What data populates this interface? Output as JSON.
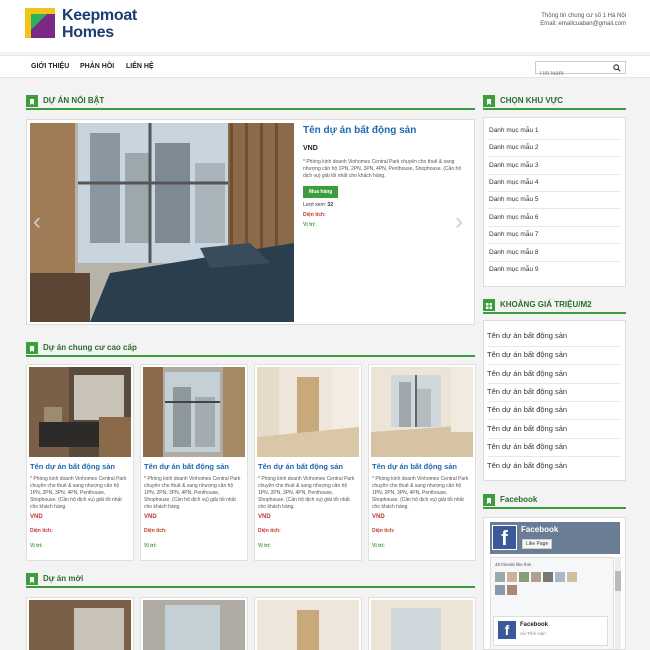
{
  "brand": {
    "logo_line1": "Keepmoat",
    "logo_line2": "Homes"
  },
  "contact": {
    "line1": "Thông tin chung cư số 1 Hà Nội",
    "line2": "Email: emailcuaban@gmail.com"
  },
  "nav": {
    "items": [
      "GIỚI THIỆU",
      "PHẢN HỒI",
      "LIÊN HỆ"
    ],
    "search_placeholder": "Tìm kiếm"
  },
  "featured": {
    "heading": "DỰ ÁN NỔI BẬT",
    "title": "Tên dự án bất động sản",
    "price": "VND",
    "description": "* Phòng kinh doanh Vinhomes Central Park chuyên cho thuê & sang nhượng căn hộ 1PN, 2PN, 3PN, 4PN, Penthouse, Shophouse. (Cần hộ dịch vụ) giải tối nhất cho khách hàng.",
    "buy_label": "Mua hàng",
    "views_label": "Lượt xem:",
    "views_value": "32",
    "area_label": "Diện tích:",
    "location_label": "Vị trí:"
  },
  "section1": {
    "heading": "Dự án chung cư cao cấp",
    "cards": [
      {
        "title": "Tên dự án bất động sản",
        "desc": "* Phòng kinh doanh Vinhomes Central Park chuyên cho thuê & sang nhượng căn hộ 1PN, 2PN, 3PN, 4PN, Penthouse, Shophouse. (Cần hộ dịch vụ) giải tối nhất cho khách hàng.",
        "price": "VND",
        "area": "Diện tích:",
        "loc": "Vị trí:"
      },
      {
        "title": "Tên dự án bất động sản",
        "desc": "* Phòng kinh doanh Vinhomes Central Park chuyên cho thuê & sang nhượng căn hộ 1PN, 2PN, 3PN, 4PN, Penthouse, Shophouse. (Cần hộ dịch vụ) giải tối nhất cho khách hàng.",
        "price": "VND",
        "area": "Diện tích:",
        "loc": "Vị trí:"
      },
      {
        "title": "Tên dự án bất động sản",
        "desc": "* Phòng kinh doanh Vinhomes Central Park chuyên cho thuê & sang nhượng căn hộ 1PN, 2PN, 3PN, 4PN, Penthouse, Shophouse. (Cần hộ dịch vụ) giải tối nhất cho khách hàng.",
        "price": "VND",
        "area": "Diện tích:",
        "loc": "Vị trí:"
      },
      {
        "title": "Tên dự án bất động sản",
        "desc": "* Phòng kinh doanh Vinhomes Central Park chuyên cho thuê & sang nhượng căn hộ 1PN, 2PN, 3PN, 4PN, Penthouse, Shophouse. (Cần hộ dịch vụ) giải tối nhất cho khách hàng.",
        "price": "VND",
        "area": "Diện tích:",
        "loc": "Vị trí:"
      }
    ]
  },
  "section2": {
    "heading": "Dự án mới"
  },
  "sidebar": {
    "region_heading": "CHỌN KHU VỰC",
    "regions": [
      "Danh mục mẫu 1",
      "Danh mục mẫu 2",
      "Danh mục mẫu 3",
      "Danh mục mẫu 4",
      "Danh mục mẫu 5",
      "Danh mục mẫu 6",
      "Danh mục mẫu 7",
      "Danh mục mẫu 8",
      "Danh mục mẫu 9"
    ],
    "price_heading": "KHOẢNG GIÁ TRIỆU/M2",
    "prices": [
      "Tên dự án bất động sản",
      "Tên dự án bất động sản",
      "Tên dự án bất động sản",
      "Tên dự án bất động sản",
      "Tên dự án bất động sản",
      "Tên dự án bất động sản",
      "Tên dự án bất động sản",
      "Tên dự án bất động sản"
    ],
    "facebook_heading": "Facebook"
  },
  "facebook": {
    "page_name": "Facebook",
    "like_label": "Like Page",
    "friends_text": "48 friends like this",
    "post_name": "Facebook",
    "post_time": "vài Thời Hạn"
  },
  "colors": {
    "accent": "#3c9d3c",
    "link": "#1f68b0",
    "price": "#c0392b"
  }
}
